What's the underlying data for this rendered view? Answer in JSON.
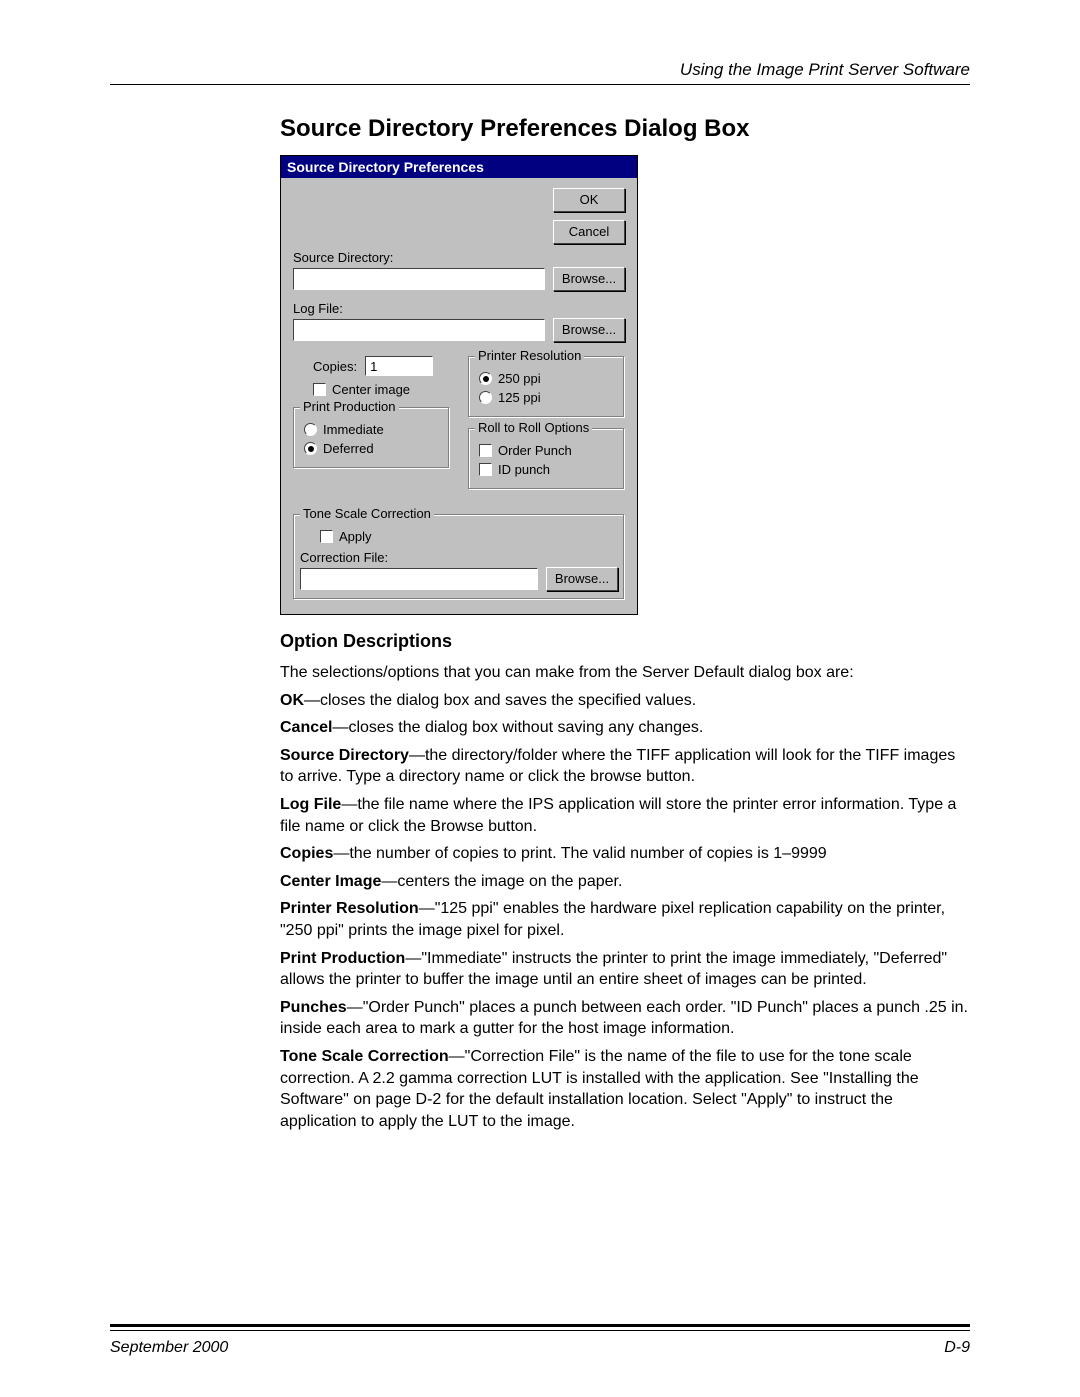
{
  "header": {
    "right": "Using the Image Print Server Software"
  },
  "heading": "Source Directory Preferences Dialog Box",
  "dialog": {
    "title": "Source Directory Preferences",
    "ok": "OK",
    "cancel": "Cancel",
    "source_label": "Source Directory:",
    "source_value": "",
    "browse": "Browse...",
    "log_label": "Log File:",
    "log_value": "",
    "copies_label": "Copies:",
    "copies_value": "1",
    "center_label": "Center image",
    "group_res": {
      "title": "Printer Resolution",
      "opt250": "250 ppi",
      "opt125": "125 ppi"
    },
    "group_prod": {
      "title": "Print Production",
      "immediate": "Immediate",
      "deferred": "Deferred"
    },
    "group_roll": {
      "title": "Roll to Roll Options",
      "order": "Order Punch",
      "id": "ID punch"
    },
    "group_tone": {
      "title": "Tone Scale Correction",
      "apply": "Apply",
      "corr_label": "Correction File:",
      "corr_value": ""
    }
  },
  "subheading": "Option Descriptions",
  "desc": {
    "intro": "The selections/options that you can make from the Server Default dialog box are:",
    "ok_b": "OK",
    "ok_t": "—closes the dialog box and saves the specified values.",
    "cancel_b": "Cancel",
    "cancel_t": "—closes the dialog box without saving any changes.",
    "src_b": "Source Directory",
    "src_t": "—the directory/folder where the TIFF application will look for the TIFF images to arrive. Type a directory name or click the browse button.",
    "log_b": "Log File",
    "log_t": "—the file name where the IPS application will store the printer error information. Type a file name or click the Browse button.",
    "copies_b": "Copies",
    "copies_t": "—the number of copies to print. The valid number of copies is 1–9999",
    "center_b": "Center Image",
    "center_t": "—centers the image on the paper.",
    "res_b": "Printer Resolution",
    "res_t": "—\"125 ppi\" enables the hardware pixel replication capability on the printer, \"250 ppi\" prints the image pixel for pixel.",
    "prod_b": "Print Production",
    "prod_t": "—\"Immediate\" instructs the printer to print the image immediately, \"Deferred\" allows the printer to buffer the image until an entire sheet of images can be printed.",
    "punch_b": "Punches",
    "punch_t": "—\"Order Punch\" places a punch between each order. \"ID Punch\" places a punch .25 in. inside each area to mark a gutter for the host image information.",
    "tone_b": "Tone Scale Correction",
    "tone_t": "—\"Correction File\" is the name of the file to use for the tone scale correction. A 2.2 gamma correction LUT is installed with the application. See \"Installing the Software\" on page D-2 for the default installation location. Select \"Apply\" to instruct the application to apply the LUT to the image."
  },
  "footer": {
    "left": "September 2000",
    "right": "D-9"
  }
}
